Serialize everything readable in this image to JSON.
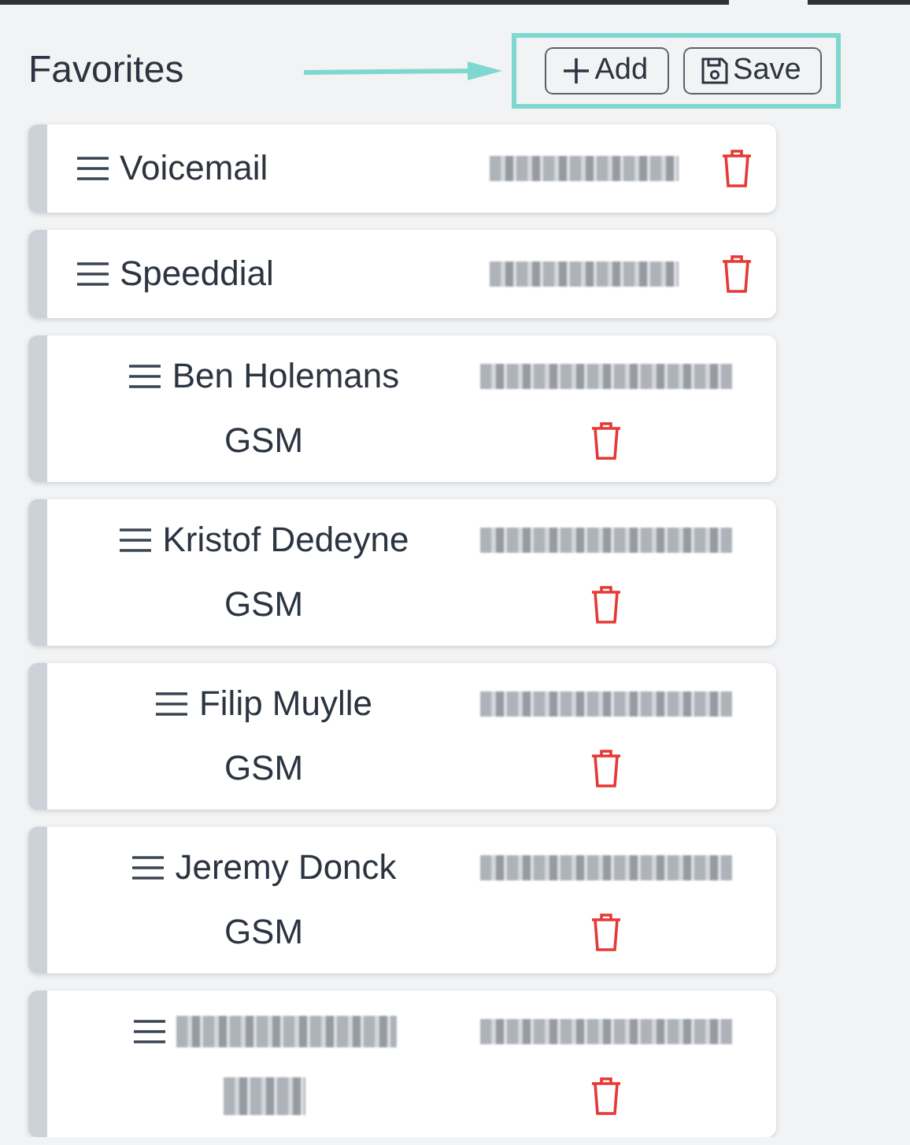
{
  "header": {
    "title": "Favorites",
    "buttons": [
      {
        "kind": "add",
        "label": "Add"
      },
      {
        "kind": "save",
        "label": "Save"
      }
    ],
    "annotation": {
      "highlighted": true
    }
  },
  "favorites": [
    {
      "kind": "simple",
      "name": "Voicemail",
      "number_blurred": true
    },
    {
      "kind": "simple",
      "name": "Speeddial",
      "number_blurred": true
    },
    {
      "kind": "contact",
      "name": "Ben Holemans",
      "type": "GSM",
      "number_blurred": true
    },
    {
      "kind": "contact",
      "name": "Kristof Dedeyne",
      "type": "GSM",
      "number_blurred": true
    },
    {
      "kind": "contact",
      "name": "Filip Muylle",
      "type": "GSM",
      "number_blurred": true
    },
    {
      "kind": "contact",
      "name": "Jeremy Donck",
      "type": "GSM",
      "number_blurred": true
    },
    {
      "kind": "contact",
      "name_blurred": true,
      "type_blurred": true,
      "number_blurred": true
    }
  ]
}
